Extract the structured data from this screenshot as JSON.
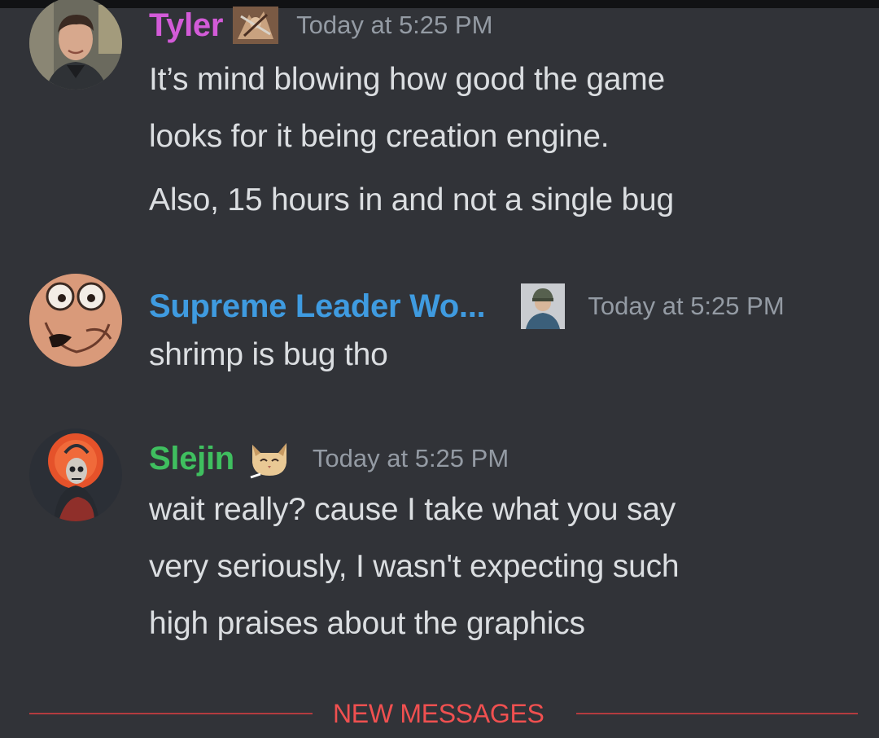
{
  "messages": [
    {
      "username": "Tyler",
      "username_color": "#d35bd8",
      "avatar_icon": "person-photo-avatar",
      "role_icon": "character-art-icon",
      "timestamp": "Today at 5:25 PM",
      "lines": [
        "It’s mind blowing how good the game",
        "looks for it being creation engine.",
        "Also, 15 hours in and not a single bug"
      ]
    },
    {
      "username": "Supreme Leader Wo...",
      "username_color": "#3f9be0",
      "avatar_icon": "cartoon-face-avatar",
      "role_icon": "soldier-portrait-icon",
      "timestamp": "Today at 5:25 PM",
      "lines": [
        "shrimp is bug tho"
      ]
    },
    {
      "username": "Slejin",
      "username_color": "#3fbf5f",
      "avatar_icon": "skeleton-art-avatar",
      "role_icon": "cat-icon",
      "timestamp": "Today at 5:25 PM",
      "lines": [
        "wait really? cause I take what you say",
        "very seriously, I wasn't expecting such",
        "high praises about the graphics"
      ]
    }
  ],
  "divider": {
    "label": "NEW MESSAGES",
    "color": "#f05050"
  },
  "theme": {
    "background": "#313338",
    "text": "#dbdee1",
    "muted": "#949ba4"
  }
}
